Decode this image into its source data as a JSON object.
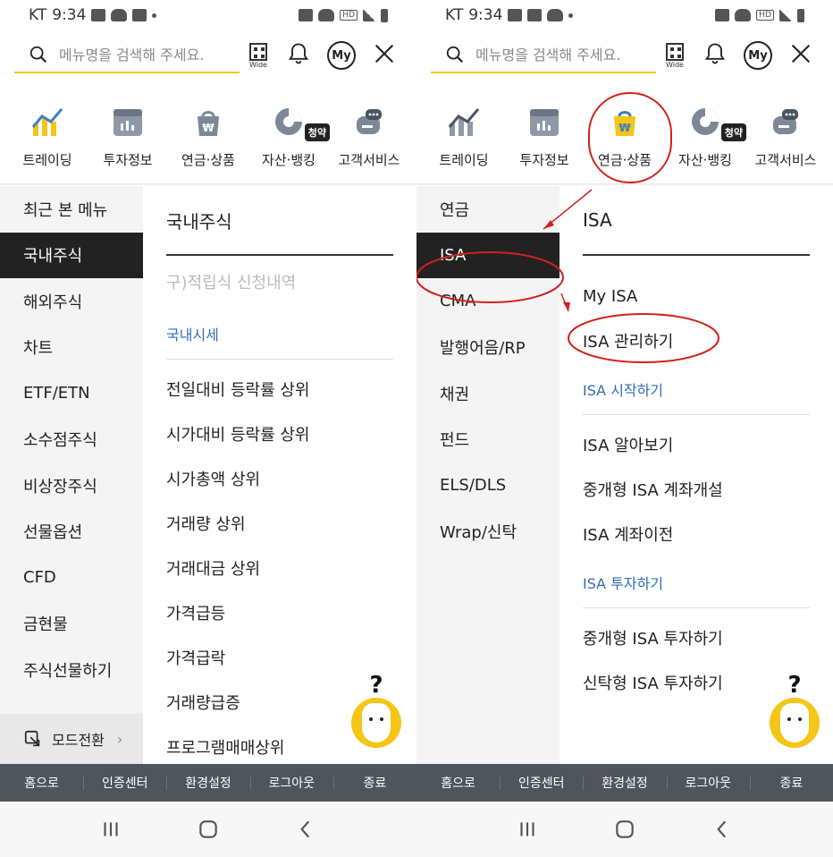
{
  "status": {
    "carrier": "KT",
    "time": "9:34",
    "hd": "HD"
  },
  "search": {
    "placeholder": "메뉴명을 검색해 주세요."
  },
  "header": {
    "qr_label": "Wide",
    "my_label": "My"
  },
  "categories": [
    {
      "label": "트레이딩",
      "icon": "trading-chart-icon"
    },
    {
      "label": "투자정보",
      "icon": "invest-info-icon"
    },
    {
      "label": "연금·상품",
      "icon": "pension-bag-icon"
    },
    {
      "label": "자산·뱅킹",
      "icon": "asset-pie-icon",
      "tag": "청약"
    },
    {
      "label": "고객서비스",
      "icon": "chat-service-icon"
    }
  ],
  "left": {
    "sidebar": [
      "최근 본 메뉴",
      "국내주식",
      "해외주식",
      "차트",
      "ETF/ETN",
      "소수점주식",
      "비상장주식",
      "선물옵션",
      "CFD",
      "금현물",
      "주식선물하기"
    ],
    "active_index": 1,
    "mode_switch": "모드전환",
    "content_title": "국내주식",
    "disabled_item": "구)적립식 신청내역",
    "section": "국내시세",
    "items": [
      "전일대비 등락률 상위",
      "시가대비 등락률 상위",
      "시가총액 상위",
      "거래량 상위",
      "거래대금 상위",
      "가격급등",
      "가격급락",
      "거래량급증",
      "프로그램매매상위"
    ]
  },
  "right": {
    "sidebar": [
      "연금",
      "ISA",
      "CMA",
      "발행어음/RP",
      "채권",
      "펀드",
      "ELS/DLS",
      "Wrap/신탁"
    ],
    "active_index": 1,
    "content_title": "ISA",
    "group1": [
      "My ISA",
      "ISA 관리하기"
    ],
    "section1": "ISA 시작하기",
    "group2": [
      "ISA 알아보기",
      "중개형 ISA 계좌개설",
      "ISA 계좌이전"
    ],
    "section2": "ISA 투자하기",
    "group3": [
      "중개형 ISA 투자하기",
      "신탁형 ISA 투자하기"
    ],
    "next_title": "CMA"
  },
  "bottom_nav": [
    "홈으로",
    "인증센터",
    "환경설정",
    "로그아웃",
    "종료"
  ],
  "colors": {
    "accent": "#f5c518",
    "section_blue": "#2f6fb5",
    "annotation_red": "#d0221c",
    "active_bg": "#222222",
    "nav_bg": "#50545b"
  }
}
